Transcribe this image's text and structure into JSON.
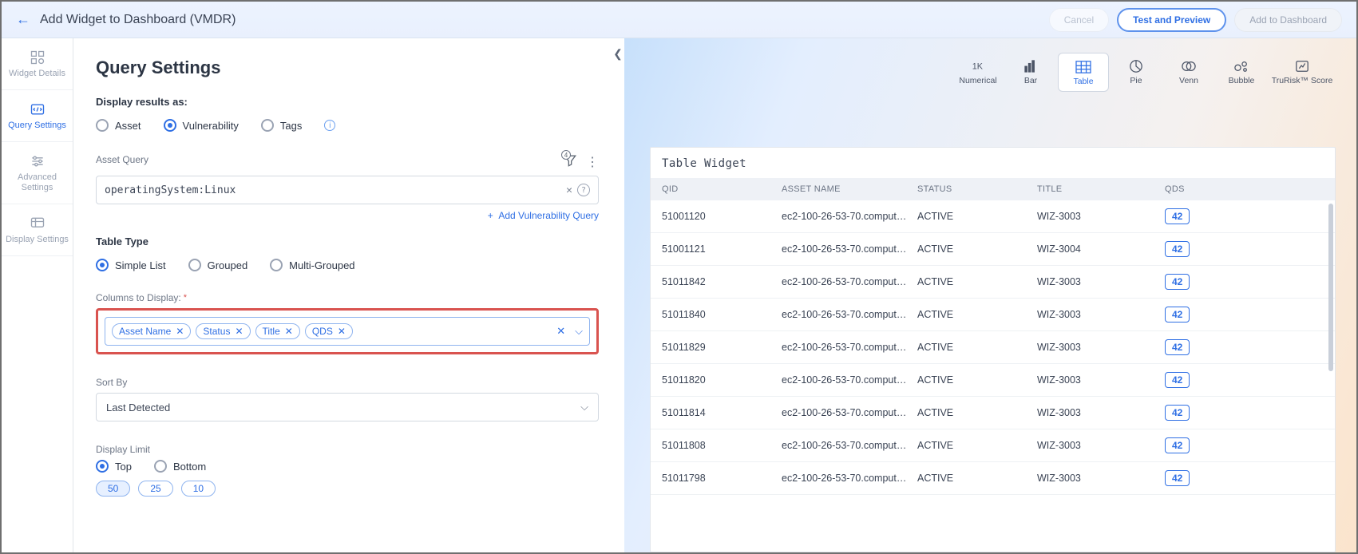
{
  "header": {
    "title": "Add Widget to Dashboard (VMDR)",
    "cancel": "Cancel",
    "test_preview": "Test and Preview",
    "add_dashboard": "Add to Dashboard"
  },
  "nav": {
    "widget_details": "Widget Details",
    "query_settings": "Query Settings",
    "advanced_settings": "Advanced Settings",
    "display_settings": "Display Settings"
  },
  "settings": {
    "title": "Query Settings",
    "display_results_label": "Display results as:",
    "result_radios": {
      "asset": "Asset",
      "vulnerability": "Vulnerability",
      "tags": "Tags"
    },
    "asset_query_label": "Asset Query",
    "asset_query_value": "operatingSystem:Linux",
    "filter_badge": "4",
    "add_vuln_query": "Add Vulnerability Query",
    "table_type_label": "Table Type",
    "table_type_radios": {
      "simple": "Simple List",
      "grouped": "Grouped",
      "multi": "Multi-Grouped"
    },
    "columns_label": "Columns to Display:",
    "columns": [
      "Asset Name",
      "Status",
      "Title",
      "QDS"
    ],
    "sort_by_label": "Sort By",
    "sort_by_value": "Last Detected",
    "display_limit_label": "Display Limit",
    "limit_radios": {
      "top": "Top",
      "bottom": "Bottom"
    },
    "limit_values": [
      "50",
      "25",
      "10"
    ]
  },
  "chart_types": {
    "numerical": "Numerical",
    "bar": "Bar",
    "table": "Table",
    "pie": "Pie",
    "venn": "Venn",
    "bubble": "Bubble",
    "trurisk": "TruRisk™ Score"
  },
  "table": {
    "title": "Table Widget",
    "headers": {
      "qid": "QID",
      "asset": "ASSET NAME",
      "status": "STATUS",
      "title": "TITLE",
      "qds": "QDS"
    },
    "rows": [
      {
        "qid": "51001120",
        "asset": "ec2-100-26-53-70.comput…",
        "status": "ACTIVE",
        "title": "WIZ-3003",
        "qds": "42"
      },
      {
        "qid": "51001121",
        "asset": "ec2-100-26-53-70.comput…",
        "status": "ACTIVE",
        "title": "WIZ-3004",
        "qds": "42"
      },
      {
        "qid": "51011842",
        "asset": "ec2-100-26-53-70.comput…",
        "status": "ACTIVE",
        "title": "WIZ-3003",
        "qds": "42"
      },
      {
        "qid": "51011840",
        "asset": "ec2-100-26-53-70.comput…",
        "status": "ACTIVE",
        "title": "WIZ-3003",
        "qds": "42"
      },
      {
        "qid": "51011829",
        "asset": "ec2-100-26-53-70.comput…",
        "status": "ACTIVE",
        "title": "WIZ-3003",
        "qds": "42"
      },
      {
        "qid": "51011820",
        "asset": "ec2-100-26-53-70.comput…",
        "status": "ACTIVE",
        "title": "WIZ-3003",
        "qds": "42"
      },
      {
        "qid": "51011814",
        "asset": "ec2-100-26-53-70.comput…",
        "status": "ACTIVE",
        "title": "WIZ-3003",
        "qds": "42"
      },
      {
        "qid": "51011808",
        "asset": "ec2-100-26-53-70.comput…",
        "status": "ACTIVE",
        "title": "WIZ-3003",
        "qds": "42"
      },
      {
        "qid": "51011798",
        "asset": "ec2-100-26-53-70.comput…",
        "status": "ACTIVE",
        "title": "WIZ-3003",
        "qds": "42"
      }
    ]
  }
}
